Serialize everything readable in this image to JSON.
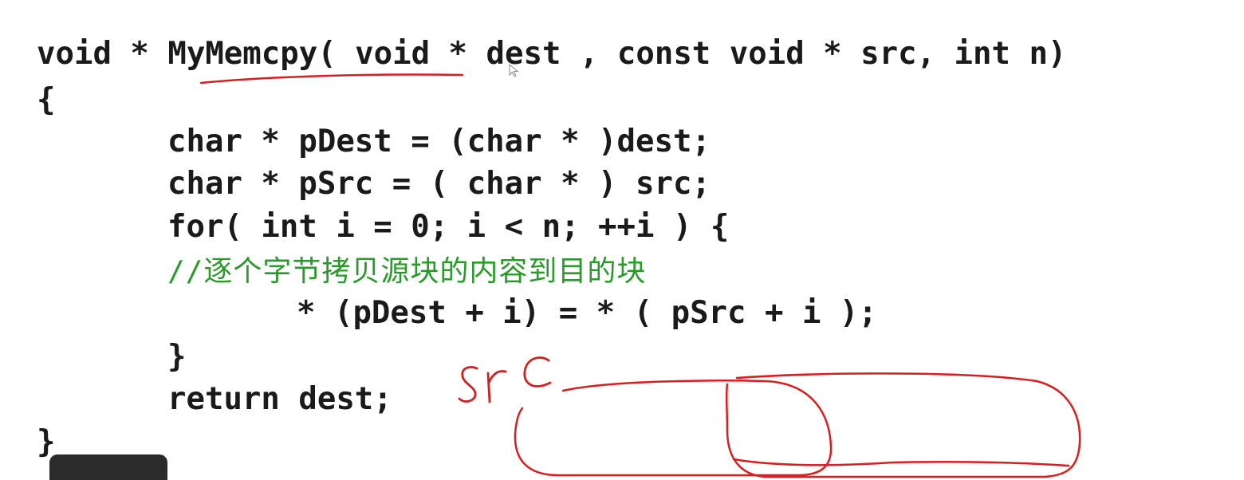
{
  "code": {
    "signature": "void * MyMemcpy( void * dest , const void * src, int n)",
    "open_brace": "{",
    "line_pdest": "char * pDest = (char * )dest;",
    "line_psrc": "char * pSrc = ( char * ) src;",
    "line_for": "for( int i = 0; i < n; ++i ) {",
    "line_comment": "//逐个字节拷贝源块的内容到目的块",
    "line_assign": "* (pDest + i) = * ( pSrc + i );",
    "inner_close_brace": "}",
    "line_return": "return dest;",
    "close_brace": "}"
  },
  "annotations": {
    "handwritten_label": "src",
    "ink_color": "#d42020"
  },
  "colors": {
    "code_text": "#1a1a1a",
    "comment_text": "#2a9a2a",
    "background": "#ffffff"
  }
}
